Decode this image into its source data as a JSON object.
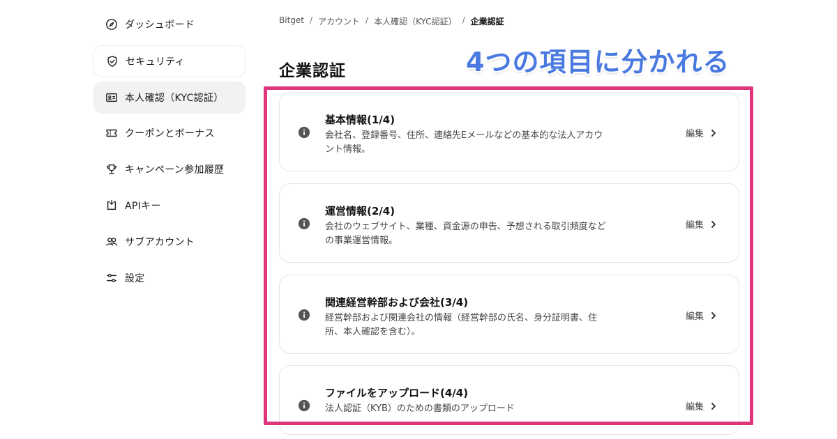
{
  "sidebar": {
    "items": [
      {
        "label": "ダッシュボード",
        "icon": "compass-icon"
      },
      {
        "label": "セキュリティ",
        "icon": "shield-check-icon"
      },
      {
        "label": "本人確認（KYC認証）",
        "icon": "id-card-icon"
      },
      {
        "label": "クーポンとボーナス",
        "icon": "ticket-icon"
      },
      {
        "label": "キャンペーン参加履歴",
        "icon": "trophy-icon"
      },
      {
        "label": "APIキー",
        "icon": "api-icon"
      },
      {
        "label": "サブアカウント",
        "icon": "users-icon"
      },
      {
        "label": "設定",
        "icon": "sliders-icon"
      }
    ]
  },
  "breadcrumb": {
    "items": [
      "Bitget",
      "アカウント",
      "本人確認（KYC認証）",
      "企業認証"
    ],
    "separator": "/"
  },
  "page_title": "企業認証",
  "annotation": "4つの項目に分かれる",
  "colors": {
    "annotation": "#4a7ae0",
    "highlight_border": "#e0357a",
    "active_nav_bg": "#f2f2f2"
  },
  "cards": [
    {
      "title": "基本情報(1/4)",
      "description": "会社名、登録番号、住所、連絡先Eメールなどの基本的な法人アカウント情報。",
      "edit_label": "編集"
    },
    {
      "title": "運営情報(2/4)",
      "description": "会社のウェブサイト、業種、資金源の申告、予想される取引頻度などの事業運営情報。",
      "edit_label": "編集"
    },
    {
      "title": "関連経営幹部および会社(3/4)",
      "description": "経営幹部および関連会社の情報（経営幹部の氏名、身分証明書、住所、本人確認を含む）。",
      "edit_label": "編集"
    },
    {
      "title": "ファイルをアップロード(4/4)",
      "description": "法人認証（KYB）のための書類のアップロード",
      "edit_label": "編集"
    }
  ]
}
